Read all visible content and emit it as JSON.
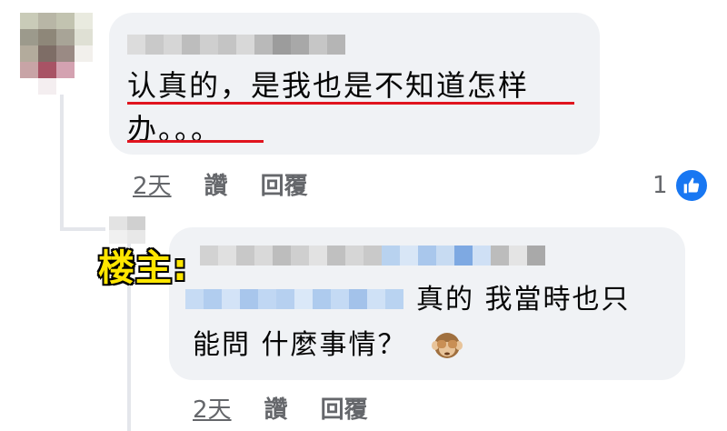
{
  "comments": [
    {
      "text_line1": "认真的，是我也是不知道怎样",
      "text_line2": "办。。。",
      "time": "2天",
      "like_label": "讚",
      "reply_label": "回覆",
      "reaction_count": "1"
    },
    {
      "op_label": "楼主:",
      "text_line1": "真的 我當時也只",
      "text_line2": "能問 什麼事情？",
      "time": "2天",
      "like_label": "讚",
      "reply_label": "回覆"
    }
  ],
  "colors": {
    "bubble": "#f0f2f5",
    "highlight_underline": "#e0141e",
    "like_blue": "#1877f2",
    "op_label_fill": "#ffe600"
  }
}
